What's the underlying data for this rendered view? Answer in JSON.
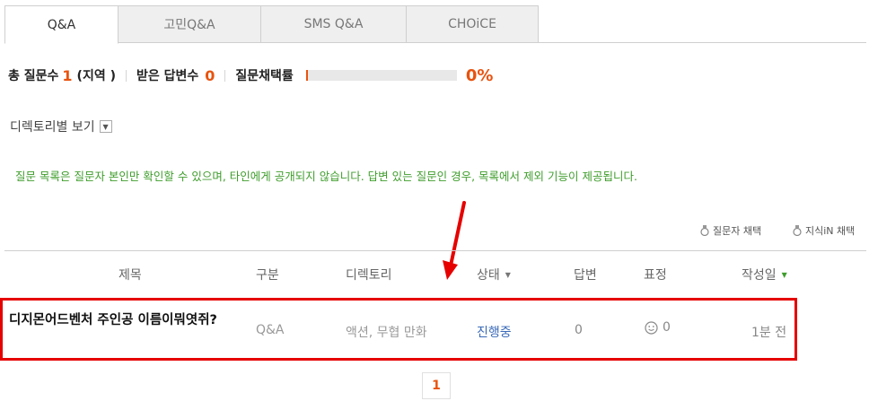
{
  "tabs": [
    {
      "label": "Q&A",
      "active": true
    },
    {
      "label": "고민Q&A",
      "active": false
    },
    {
      "label": "SMS Q&A",
      "active": false
    },
    {
      "label": "CHOiCE",
      "active": false
    }
  ],
  "stats": {
    "questions_label": "총 질문수",
    "questions_count": "1",
    "region_label": "(지역 )",
    "answers_label": "받은 답변수",
    "answers_count": "0",
    "adoption_label": "질문채택률",
    "adoption_rate": 0,
    "adoption_rate_text": "0%"
  },
  "directory_view": {
    "label": "디렉토리별 보기"
  },
  "notice": "질문 목록은 질문자 본인만 확인할 수 있으며, 타인에게 공개되지 않습니다. 답변 있는 질문인 경우, 목록에서 제외 기능이 제공됩니다.",
  "legend": {
    "asker_adopt": "질문자 채택",
    "kin_adopt": "지식iN 채택"
  },
  "table": {
    "headers": {
      "title": "제목",
      "type": "구분",
      "directory": "디렉토리",
      "status": "상태",
      "answers": "답변",
      "expression": "표정",
      "date": "작성일"
    },
    "rows": [
      {
        "title": "디지몬어드벤처 주인공 이름이뭐엿쥐?",
        "type": "Q&A",
        "directory": "액션, 무협 만화",
        "status": "진행중",
        "answers": "0",
        "expression": "0",
        "date": "1분 전"
      }
    ]
  },
  "pagination": {
    "current": "1"
  },
  "colors": {
    "accent": "#e8530e",
    "notice_green": "#3f9d2c",
    "status_blue": "#3a6ab8",
    "highlight_red": "#e60000"
  }
}
